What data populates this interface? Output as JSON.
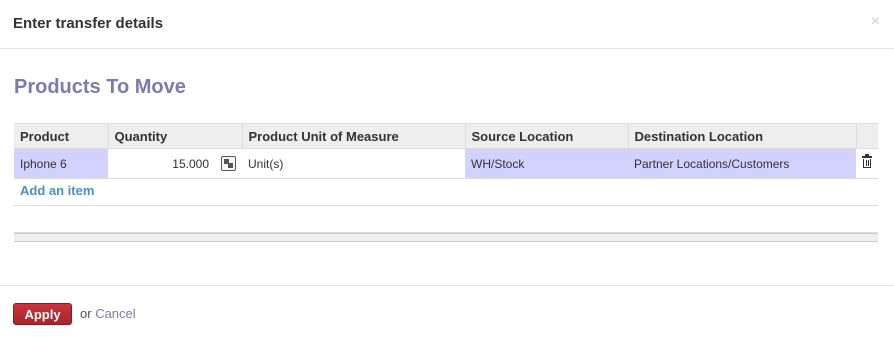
{
  "dialog": {
    "title": "Enter transfer details",
    "close_glyph": "×"
  },
  "section": {
    "title": "Products To Move"
  },
  "grid": {
    "columns": [
      "Product",
      "Quantity",
      "Product Unit of Measure",
      "Source Location",
      "Destination Location"
    ],
    "rows": [
      {
        "product": "Iphone 6",
        "quantity": "15.000",
        "uom": "Unit(s)",
        "source": "WH/Stock",
        "destination": "Partner Locations/Customers"
      }
    ],
    "add_item_label": "Add an item"
  },
  "colors": {
    "accent": "#7c7bad",
    "required_field": "#d2d2ff",
    "apply_button": "#b52a33",
    "link": "#4c8fc7"
  },
  "icons": {
    "split": "split-icon",
    "delete": "trash-icon",
    "close": "close-icon"
  },
  "footer": {
    "apply_label": "Apply",
    "or_label": "or",
    "cancel_label": "Cancel"
  }
}
